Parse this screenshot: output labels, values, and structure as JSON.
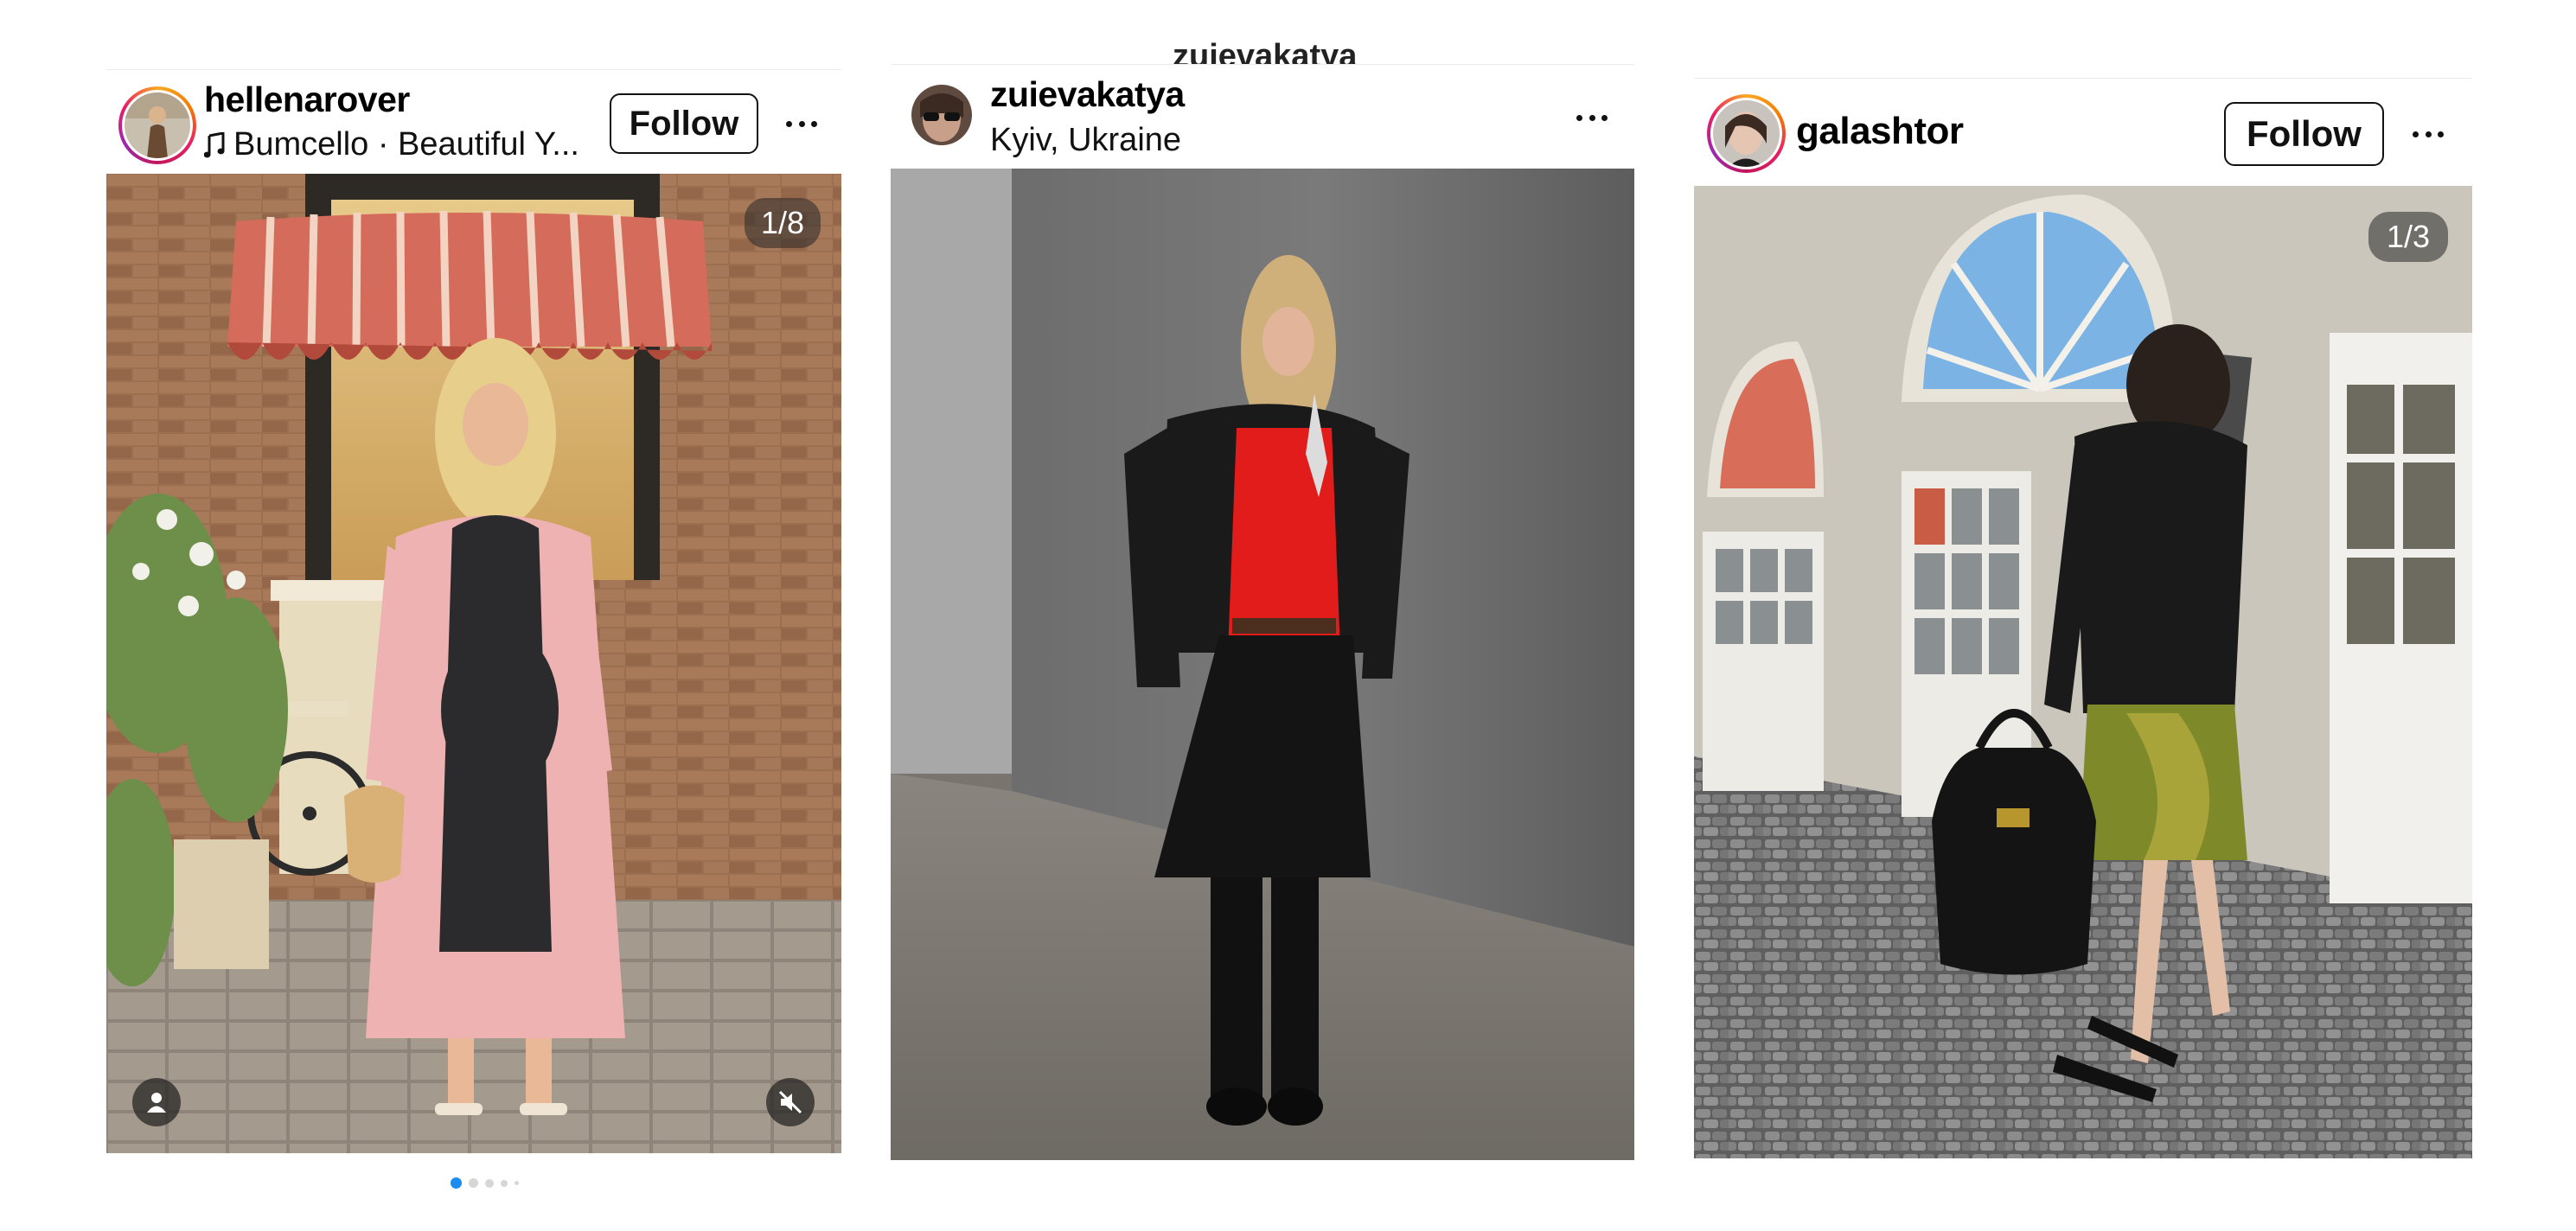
{
  "posts": [
    {
      "username": "hellenarover",
      "audio": "Bumcello · Beautiful Y...",
      "follow_label": "Follow",
      "counter": "1/8",
      "carousel": {
        "count": 5,
        "active": 0
      },
      "colors": {
        "active_dot": "#1d8cf0"
      },
      "icons": [
        "music-note-icon",
        "more-options-icon",
        "user-tag-icon",
        "mute-icon"
      ]
    },
    {
      "top_text": "zuievakatya",
      "username": "zuievakatya",
      "location": "Kyiv, Ukraine",
      "icons": [
        "more-options-icon"
      ]
    },
    {
      "username": "galashtor",
      "follow_label": "Follow",
      "counter": "1/3",
      "icons": [
        "more-options-icon"
      ]
    }
  ]
}
